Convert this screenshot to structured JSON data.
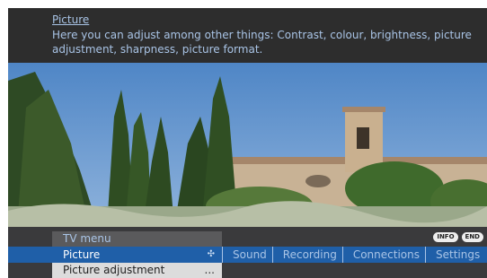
{
  "info": {
    "title": "Picture",
    "description": "Here you can adjust among other things: Contrast, colour, brightness, picture adjustment, sharpness, picture format."
  },
  "badges": [
    "INFO",
    "END"
  ],
  "menu": {
    "title": "TV menu",
    "active_tab": "Picture",
    "tabs": [
      "Sound",
      "Recording",
      "Connections",
      "Settings"
    ],
    "subitem": "Picture adjustment",
    "subitem_more": "..."
  },
  "colors": {
    "accent": "#1f5fa8",
    "text_light": "#a9c4e6",
    "panel": "#2d2d2d"
  },
  "icons": {
    "nav": "four-way-arrow-icon"
  }
}
